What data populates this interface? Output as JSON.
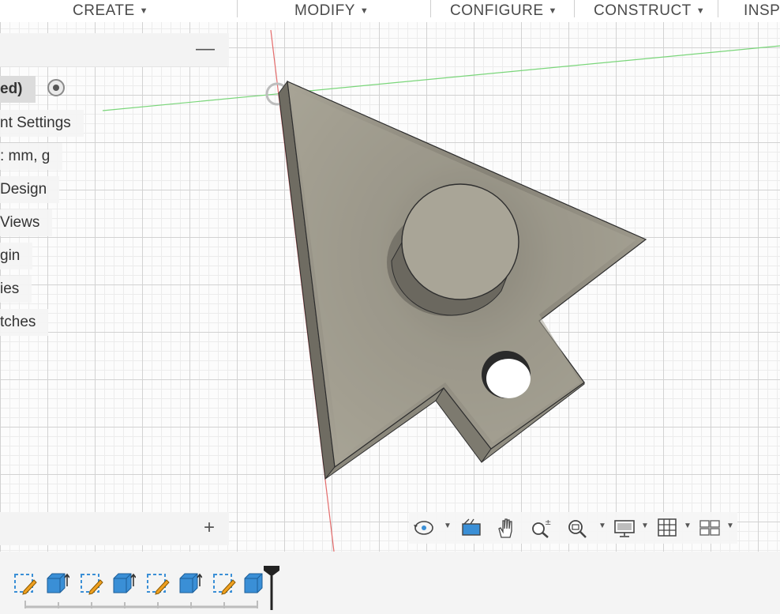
{
  "toolbar": {
    "menus": [
      {
        "label": "CREATE"
      },
      {
        "label": "MODIFY"
      },
      {
        "label": "CONFIGURE"
      },
      {
        "label": "CONSTRUCT"
      },
      {
        "label": "INSP"
      }
    ]
  },
  "browser": {
    "items": [
      {
        "label": "ed)"
      },
      {
        "label": "nt Settings"
      },
      {
        "label": ": mm, g"
      },
      {
        "label": "Design"
      },
      {
        "label": "Views"
      },
      {
        "label": "gin"
      },
      {
        "label": "ies"
      },
      {
        "label": "tches"
      }
    ],
    "collapse_icon": "minus-icon",
    "expand_icon": "plus-icon"
  },
  "navigation_icons": [
    "orbit-icon",
    "look-at-icon",
    "pan-icon",
    "zoom-icon",
    "fit-icon",
    "display-settings-icon",
    "grid-icon",
    "viewports-icon"
  ],
  "timeline": {
    "items": [
      "sketch-icon",
      "extrude-icon",
      "sketch-icon",
      "extrude-icon",
      "sketch-icon",
      "extrude-icon",
      "sketch-icon",
      "extrude-icon"
    ]
  },
  "colors": {
    "body": "#a9a698",
    "body_dark": "#6f6c62",
    "accent_blue": "#3a8fd6",
    "sketch_orange": "#f0a020"
  }
}
